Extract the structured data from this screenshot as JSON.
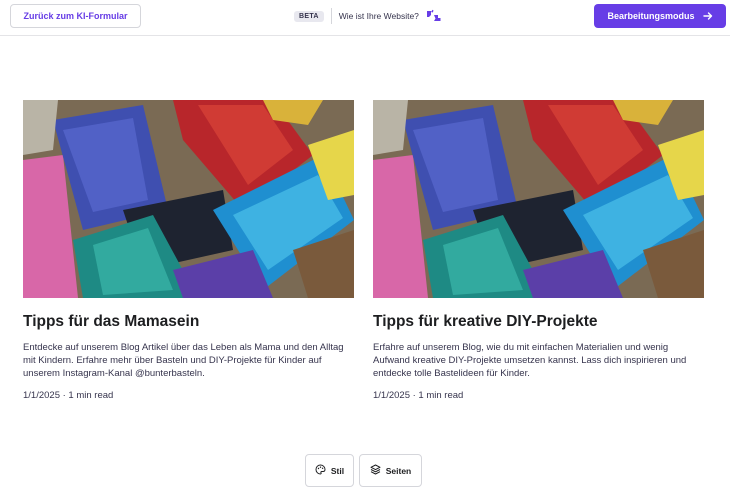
{
  "topbar": {
    "back_label": "Zurück zum KI-Formular",
    "beta_label": "BETA",
    "question_label": "Wie ist Ihre Website?",
    "edit_label": "Bearbeitungsmodus"
  },
  "posts": [
    {
      "title": "Tipps für das Mamasein",
      "description": "Entdecke auf unserem Blog Artikel über das Leben als Mama und den Alltag mit Kindern. Erfahre mehr über Basteln und DIY-Projekte für Kinder auf unserem Instagram-Kanal @bunterbasteln.",
      "meta": "1/1/2025 · 1 min read"
    },
    {
      "title": "Tipps für kreative DIY-Projekte",
      "description": "Erfahre auf unserem Blog, wie du mit einfachen Materialien und wenig Aufwand kreative DIY-Projekte umsetzen kannst. Lass dich inspirieren und entdecke tolle Bastelideen für Kinder.",
      "meta": "1/1/2025 · 1 min read"
    }
  ],
  "bottom": {
    "style_label": "Stil",
    "pages_label": "Seiten"
  },
  "colors": {
    "accent": "#673de6",
    "text": "#1d1e20"
  },
  "icons": {
    "question": "thumbs-feedback-icon",
    "edit_arrow": "arrow-right-icon",
    "style": "palette-icon",
    "pages": "layers-icon"
  }
}
